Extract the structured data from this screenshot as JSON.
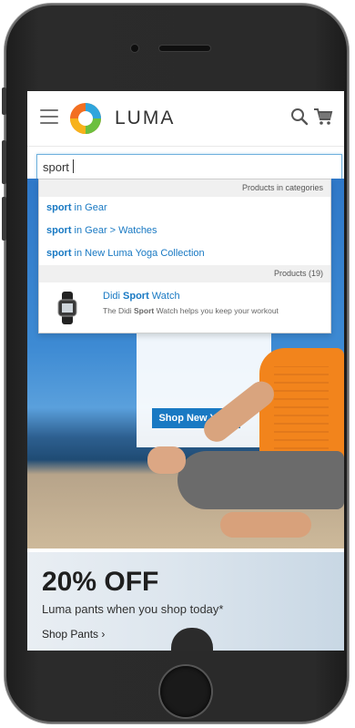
{
  "header": {
    "brand": "LUMA",
    "icons": {
      "menu": "hamburger-menu-icon",
      "search": "search-icon",
      "cart": "cart-icon"
    }
  },
  "search": {
    "value": "sport"
  },
  "autocomplete": {
    "categories_header": "Products in categories",
    "categories": [
      {
        "term": "sport",
        "rest": " in Gear"
      },
      {
        "term": "sport",
        "rest": " in Gear > Watches"
      },
      {
        "term": "sport",
        "rest": " in New Luma Yoga Collection"
      }
    ],
    "products_header": "Products (19)",
    "product": {
      "name_prefix": "Didi ",
      "name_term": "Sport",
      "name_suffix": " Watch",
      "desc_prefix": "The Didi ",
      "desc_term": "Sport",
      "desc_suffix": " Watch helps you keep your workout"
    }
  },
  "hero": {
    "cta": "Shop New Yoga"
  },
  "promo": {
    "title": "20% OFF",
    "subtitle": "Luma pants when you shop today*",
    "link": "Shop Pants ›"
  },
  "colors": {
    "link": "#1979c3",
    "accent": "#f2841c",
    "focus_border": "#6fb0dd"
  }
}
